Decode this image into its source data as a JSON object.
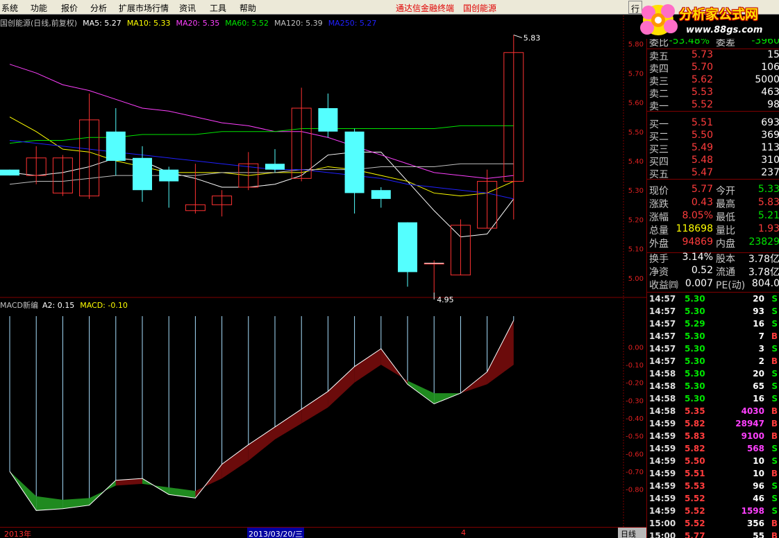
{
  "menu": {
    "items": [
      "系统",
      "功能",
      "报价",
      "分析",
      "扩展市场行情",
      "资讯",
      "工具",
      "帮助"
    ],
    "promos": [
      "通达信金融终端",
      "国创能源"
    ],
    "stock_tab": "行"
  },
  "logo": {
    "brand": "分析家公式网",
    "url": "www.88gs.com"
  },
  "ma_header": {
    "title": "国创能源(日线,前复权)",
    "ma5": "MA5: 5.27",
    "ma10": "MA10: 5.33",
    "ma20": "MA20: 5.35",
    "ma60": "MA60: 5.52",
    "ma120": "MA120: 5.39",
    "ma250": "MA250: 5.27",
    "colors": {
      "ma5": "#ffffff",
      "ma10": "#ffff00",
      "ma20": "#ff40ff",
      "ma60": "#00e600",
      "ma120": "#c0c0c0",
      "ma250": "#2020ff"
    }
  },
  "macd_header": {
    "title": "MACD新编",
    "a2": "A2: 0.15",
    "macd": "MACD: -0.10"
  },
  "axis": {
    "left": "2013年",
    "selected": "2013/03/20/三",
    "mark": "4",
    "period": "日线"
  },
  "chart_data": [
    {
      "type": "candlestick",
      "title": "国创能源(日线,前复权)",
      "ylim": [
        4.95,
        5.85
      ],
      "y_ticks": [
        "5.80",
        "5.70",
        "5.60",
        "5.50",
        "5.40",
        "5.30",
        "5.20",
        "5.10",
        "5.00"
      ],
      "y_tick_values": [
        5.8,
        5.7,
        5.6,
        5.5,
        5.4,
        5.3,
        5.2,
        5.1,
        5.0
      ],
      "high_label": "5.83",
      "low_label": "4.95",
      "candles": [
        {
          "o": 5.37,
          "c": 5.35,
          "h": 5.37,
          "l": 5.35
        },
        {
          "o": 5.35,
          "c": 5.41,
          "h": 5.45,
          "l": 5.32
        },
        {
          "o": 5.29,
          "c": 5.41,
          "h": 5.42,
          "l": 5.28
        },
        {
          "o": 5.28,
          "c": 5.54,
          "h": 5.63,
          "l": 5.27
        },
        {
          "o": 5.5,
          "c": 5.4,
          "h": 5.58,
          "l": 5.35
        },
        {
          "o": 5.41,
          "c": 5.3,
          "h": 5.45,
          "l": 5.26
        },
        {
          "o": 5.37,
          "c": 5.33,
          "h": 5.38,
          "l": 5.24
        },
        {
          "o": 5.23,
          "c": 5.25,
          "h": 5.39,
          "l": 5.22
        },
        {
          "o": 5.25,
          "c": 5.28,
          "h": 5.3,
          "l": 5.21
        },
        {
          "o": 5.31,
          "c": 5.39,
          "h": 5.43,
          "l": 5.3
        },
        {
          "o": 5.39,
          "c": 5.37,
          "h": 5.44,
          "l": 5.36
        },
        {
          "o": 5.34,
          "c": 5.58,
          "h": 5.65,
          "l": 5.33
        },
        {
          "o": 5.58,
          "c": 5.5,
          "h": 5.63,
          "l": 5.48
        },
        {
          "o": 5.5,
          "c": 5.29,
          "h": 5.51,
          "l": 5.22
        },
        {
          "o": 5.3,
          "c": 5.27,
          "h": 5.31,
          "l": 5.24
        },
        {
          "o": 5.19,
          "c": 5.02,
          "h": 5.19,
          "l": 4.97
        },
        {
          "o": 5.05,
          "c": 5.05,
          "h": 5.06,
          "l": 4.95
        },
        {
          "o": 5.01,
          "c": 5.18,
          "h": 5.2,
          "l": 5.01
        },
        {
          "o": 5.17,
          "c": 5.33,
          "h": 5.37,
          "l": 5.17
        },
        {
          "o": 5.33,
          "c": 5.77,
          "h": 5.83,
          "l": 5.2
        }
      ],
      "series": [
        {
          "name": "MA5",
          "color": "#ffffff",
          "values": [
            5.36,
            5.35,
            5.36,
            5.38,
            5.41,
            5.4,
            5.36,
            5.34,
            5.31,
            5.31,
            5.32,
            5.35,
            5.42,
            5.43,
            5.43,
            5.33,
            5.23,
            5.14,
            5.15,
            5.27
          ]
        },
        {
          "name": "MA10",
          "color": "#ffff00",
          "values": [
            5.55,
            5.5,
            5.44,
            5.43,
            5.4,
            5.38,
            5.36,
            5.36,
            5.36,
            5.35,
            5.36,
            5.36,
            5.38,
            5.37,
            5.35,
            5.33,
            5.29,
            5.28,
            5.29,
            5.33
          ]
        },
        {
          "name": "MA20",
          "color": "#ff40ff",
          "values": [
            5.73,
            5.7,
            5.66,
            5.64,
            5.61,
            5.58,
            5.57,
            5.55,
            5.53,
            5.52,
            5.5,
            5.5,
            5.48,
            5.45,
            5.42,
            5.39,
            5.36,
            5.35,
            5.34,
            5.35
          ]
        },
        {
          "name": "MA60",
          "color": "#00e600",
          "values": [
            5.46,
            5.47,
            5.47,
            5.48,
            5.48,
            5.49,
            5.49,
            5.49,
            5.5,
            5.5,
            5.5,
            5.51,
            5.51,
            5.51,
            5.51,
            5.51,
            5.51,
            5.52,
            5.52,
            5.52
          ]
        },
        {
          "name": "MA120",
          "color": "#c0c0c0",
          "values": [
            5.32,
            5.33,
            5.33,
            5.34,
            5.35,
            5.35,
            5.35,
            5.35,
            5.36,
            5.36,
            5.36,
            5.37,
            5.37,
            5.37,
            5.38,
            5.38,
            5.38,
            5.39,
            5.39,
            5.39
          ]
        },
        {
          "name": "MA250",
          "color": "#2020ff",
          "values": [
            5.47,
            5.46,
            5.45,
            5.44,
            5.43,
            5.42,
            5.41,
            5.4,
            5.39,
            5.38,
            5.37,
            5.37,
            5.36,
            5.35,
            5.34,
            5.32,
            5.31,
            5.3,
            5.29,
            5.27
          ]
        }
      ]
    },
    {
      "type": "area",
      "title": "MACD新编",
      "ylim": [
        -0.95,
        0.15
      ],
      "y_ticks": [
        "0.00",
        "-0.10",
        "-0.20",
        "-0.30",
        "-0.40",
        "-0.50",
        "-0.60",
        "-0.70",
        "-0.80"
      ],
      "y_tick_values": [
        0,
        -0.1,
        -0.2,
        -0.3,
        -0.4,
        -0.5,
        -0.6,
        -0.7,
        -0.8
      ],
      "series": [
        {
          "name": "A2",
          "color": "#ffffff",
          "values": [
            -0.7,
            -0.92,
            -0.91,
            -0.89,
            -0.75,
            -0.74,
            -0.83,
            -0.85,
            -0.66,
            -0.55,
            -0.45,
            -0.35,
            -0.25,
            -0.11,
            -0.01,
            -0.21,
            -0.32,
            -0.26,
            -0.14,
            0.15
          ]
        },
        {
          "name": "MACD",
          "color": "#c0c0c0",
          "values": [
            -0.7,
            -0.84,
            -0.86,
            -0.85,
            -0.78,
            -0.77,
            -0.79,
            -0.81,
            -0.74,
            -0.64,
            -0.52,
            -0.43,
            -0.34,
            -0.2,
            -0.1,
            -0.19,
            -0.26,
            -0.26,
            -0.21,
            -0.1
          ]
        }
      ],
      "pos_color": "#6b0b0b",
      "neg_color": "#1f8a1f",
      "bar_color": "#a8e0ff"
    }
  ],
  "quote": {
    "top": {
      "k": "委比",
      "v": "-53.48%",
      "k2": "委差",
      "v2": "-3960"
    },
    "sells": [
      {
        "k": "卖五",
        "p": "5.73",
        "v": "15"
      },
      {
        "k": "卖四",
        "p": "5.70",
        "v": "106"
      },
      {
        "k": "卖三",
        "p": "5.62",
        "v": "5000"
      },
      {
        "k": "卖二",
        "p": "5.53",
        "v": "463"
      },
      {
        "k": "卖一",
        "p": "5.52",
        "v": "98"
      }
    ],
    "buys": [
      {
        "k": "买一",
        "p": "5.51",
        "v": "693"
      },
      {
        "k": "买二",
        "p": "5.50",
        "v": "369"
      },
      {
        "k": "买三",
        "p": "5.49",
        "v": "113"
      },
      {
        "k": "买四",
        "p": "5.48",
        "v": "310"
      },
      {
        "k": "买五",
        "p": "5.47",
        "v": "237"
      }
    ],
    "stats": [
      {
        "k": "现价",
        "v": "5.77",
        "vc": "red",
        "k2": "今开",
        "v2": "5.33",
        "v2c": "green"
      },
      {
        "k": "涨跌",
        "v": "0.43",
        "vc": "red",
        "k2": "最高",
        "v2": "5.83",
        "v2c": "red"
      },
      {
        "k": "涨幅",
        "v": "8.05%",
        "vc": "red",
        "k2": "最低",
        "v2": "5.21",
        "v2c": "green"
      },
      {
        "k": "总量",
        "v": "118698",
        "vc": "yellow",
        "k2": "量比",
        "v2": "1.93",
        "v2c": "red"
      },
      {
        "k": "外盘",
        "v": "94869",
        "vc": "red",
        "k2": "内盘",
        "v2": "23829",
        "v2c": "green"
      }
    ],
    "fin": [
      {
        "k": "换手",
        "v": "3.14%",
        "k2": "股本",
        "v2": "3.78亿"
      },
      {
        "k": "净资",
        "v": "0.52",
        "k2": "流通",
        "v2": "3.78亿"
      },
      {
        "k": "收益㈣",
        "v": "0.007",
        "k2": "PE(动)",
        "v2": "804.0"
      }
    ],
    "ticks": [
      {
        "t": "14:57",
        "p": "5.30",
        "pc": "green",
        "v": "20",
        "vc": "white",
        "s": "S",
        "sc": "green"
      },
      {
        "t": "14:57",
        "p": "5.30",
        "pc": "green",
        "v": "93",
        "vc": "white",
        "s": "S",
        "sc": "green"
      },
      {
        "t": "14:57",
        "p": "5.29",
        "pc": "green",
        "v": "16",
        "vc": "white",
        "s": "S",
        "sc": "green"
      },
      {
        "t": "14:57",
        "p": "5.30",
        "pc": "green",
        "v": "7",
        "vc": "white",
        "s": "B",
        "sc": "red"
      },
      {
        "t": "14:57",
        "p": "5.30",
        "pc": "green",
        "v": "3",
        "vc": "white",
        "s": "S",
        "sc": "green"
      },
      {
        "t": "14:57",
        "p": "5.30",
        "pc": "green",
        "v": "2",
        "vc": "white",
        "s": "B",
        "sc": "red"
      },
      {
        "t": "14:58",
        "p": "5.30",
        "pc": "green",
        "v": "20",
        "vc": "white",
        "s": "S",
        "sc": "green"
      },
      {
        "t": "14:58",
        "p": "5.30",
        "pc": "green",
        "v": "65",
        "vc": "white",
        "s": "S",
        "sc": "green"
      },
      {
        "t": "14:58",
        "p": "5.30",
        "pc": "green",
        "v": "16",
        "vc": "white",
        "s": "S",
        "sc": "green"
      },
      {
        "t": "14:58",
        "p": "5.35",
        "pc": "red",
        "v": "4030",
        "vc": "magenta",
        "s": "B",
        "sc": "red"
      },
      {
        "t": "14:59",
        "p": "5.82",
        "pc": "red",
        "v": "28947",
        "vc": "magenta",
        "s": "B",
        "sc": "red"
      },
      {
        "t": "14:59",
        "p": "5.83",
        "pc": "red",
        "v": "9100",
        "vc": "magenta",
        "s": "B",
        "sc": "red"
      },
      {
        "t": "14:59",
        "p": "5.82",
        "pc": "red",
        "v": "568",
        "vc": "magenta",
        "s": "S",
        "sc": "green"
      },
      {
        "t": "14:59",
        "p": "5.50",
        "pc": "red",
        "v": "10",
        "vc": "white",
        "s": "S",
        "sc": "green"
      },
      {
        "t": "14:59",
        "p": "5.51",
        "pc": "red",
        "v": "10",
        "vc": "white",
        "s": "B",
        "sc": "red"
      },
      {
        "t": "14:59",
        "p": "5.53",
        "pc": "red",
        "v": "96",
        "vc": "white",
        "s": "S",
        "sc": "green"
      },
      {
        "t": "14:59",
        "p": "5.52",
        "pc": "red",
        "v": "46",
        "vc": "white",
        "s": "S",
        "sc": "green"
      },
      {
        "t": "14:59",
        "p": "5.52",
        "pc": "red",
        "v": "1598",
        "vc": "magenta",
        "s": "S",
        "sc": "green"
      },
      {
        "t": "15:00",
        "p": "5.52",
        "pc": "red",
        "v": "356",
        "vc": "white",
        "s": "B",
        "sc": "red"
      },
      {
        "t": "15:00",
        "p": "5.77",
        "pc": "red",
        "v": "55",
        "vc": "white",
        "s": "B",
        "sc": "red"
      }
    ]
  }
}
